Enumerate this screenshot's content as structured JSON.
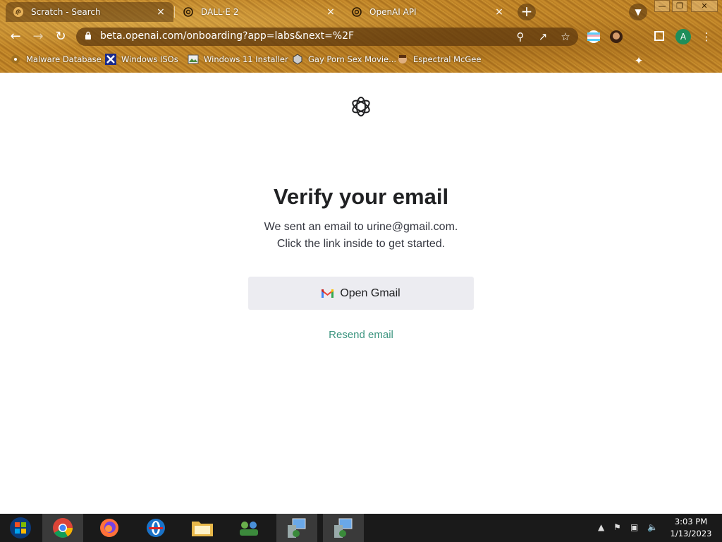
{
  "browser": {
    "tabs": [
      {
        "title": "Scratch - Search",
        "active": true
      },
      {
        "title": "DALL·E 2",
        "active": false
      },
      {
        "title": "OpenAI API",
        "active": false
      }
    ],
    "tab_close_glyph": "×",
    "new_tab_glyph": "+",
    "url": "beta.openai.com/onboarding?app=labs&next=%2F",
    "window_controls": {
      "minimize": "—",
      "restore": "❐",
      "close": "✕"
    },
    "profile_initial": "A",
    "bookmarks": [
      {
        "label": "Malware Database"
      },
      {
        "label": "Windows ISOs"
      },
      {
        "label": "Windows 11 Installer"
      },
      {
        "label": "Gay Porn Sex Movie..."
      },
      {
        "label": "Espectral McGee"
      }
    ]
  },
  "page": {
    "heading": "Verify your email",
    "line1": "We sent an email to urine@gmail.com.",
    "line2": "Click the link inside to get started.",
    "open_gmail_label": "Open Gmail",
    "resend_label": "Resend email",
    "accent_color": "#10a37f"
  },
  "taskbar": {
    "apps": [
      "windows-start",
      "chrome",
      "firefox",
      "opera",
      "file-explorer",
      "network-app",
      "remote-desktop-1",
      "remote-desktop-2"
    ],
    "time": "3:03 PM",
    "date": "1/13/2023"
  }
}
